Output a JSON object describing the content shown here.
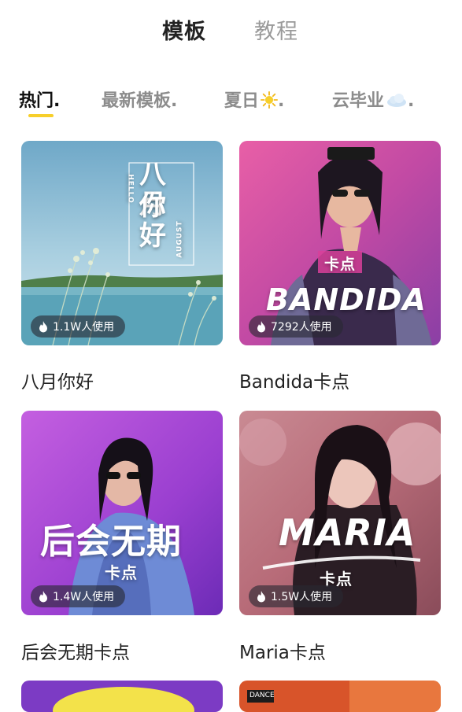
{
  "top_tabs": [
    {
      "label": "模板",
      "active": true
    },
    {
      "label": "教程",
      "active": false
    }
  ],
  "categories": [
    {
      "label": "热门",
      "suffix": ".",
      "active": true,
      "icon": null
    },
    {
      "label": "最新模板",
      "suffix": ".",
      "active": false,
      "icon": null
    },
    {
      "label": "夏日",
      "suffix": ".",
      "active": false,
      "icon": "sun-icon"
    },
    {
      "label": "云毕业",
      "suffix": ".",
      "active": false,
      "icon": "cloud-icon"
    }
  ],
  "accent_color": "#f7cf2a",
  "templates": [
    {
      "title": "八月你好",
      "usage": "1.1W人使用",
      "art_lines": [
        "八月",
        "你好"
      ],
      "art_small_left": "HELLO",
      "art_small_right": "AUGUST"
    },
    {
      "title": "Bandida卡点",
      "usage": "7292人使用",
      "art_tag": "卡点",
      "art_main": "BANDIDA"
    },
    {
      "title": "后会无期卡点",
      "usage": "1.4W人使用",
      "art_main": "后会无期",
      "art_tag": "卡点"
    },
    {
      "title": "Maria卡点",
      "usage": "1.5W人使用",
      "art_main": "MARIA",
      "art_tag": "卡点"
    }
  ],
  "partial_card_text": "DANCE"
}
